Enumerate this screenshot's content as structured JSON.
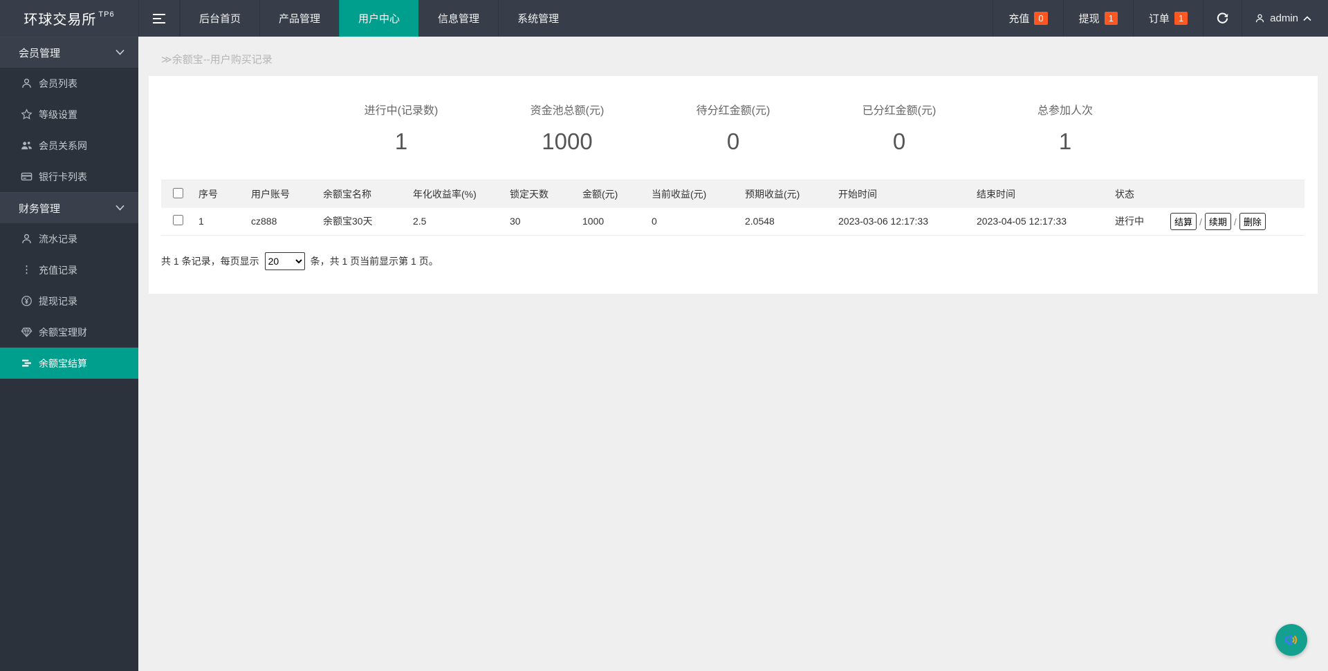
{
  "colors": {
    "teal": "#009e8c",
    "badge_orange": "#ff5722",
    "topbar_bg": "#373e4a",
    "sidebar_bg": "#2b323c",
    "page_bg": "#efefef"
  },
  "topbar": {
    "logo": "环球交易所",
    "logo_sup": "TP6",
    "nav": [
      {
        "label": "后台首页",
        "active": false
      },
      {
        "label": "产品管理",
        "active": false
      },
      {
        "label": "用户中心",
        "active": true
      },
      {
        "label": "信息管理",
        "active": false
      },
      {
        "label": "系统管理",
        "active": false
      }
    ],
    "right": {
      "recharge": {
        "label": "充值",
        "count": "0"
      },
      "withdraw": {
        "label": "提现",
        "count": "1"
      },
      "order": {
        "label": "订单",
        "count": "1"
      },
      "username": "admin"
    }
  },
  "sidebar": {
    "sections": [
      {
        "label": "会员管理",
        "items": [
          {
            "icon": "user-icon",
            "label": "会员列表"
          },
          {
            "icon": "star-icon",
            "label": "等级设置"
          },
          {
            "icon": "users-icon",
            "label": "会员关系网"
          },
          {
            "icon": "bank-card-icon",
            "label": "银行卡列表"
          }
        ]
      },
      {
        "label": "财务管理",
        "items": [
          {
            "icon": "user-icon",
            "label": "流水记录"
          },
          {
            "icon": "dots-icon",
            "label": "充值记录"
          },
          {
            "icon": "yen-circle-icon",
            "label": "提现记录"
          },
          {
            "icon": "gem-icon",
            "label": "余额宝理财"
          },
          {
            "icon": "list-icon",
            "label": "余额宝结算",
            "active": true
          }
        ]
      }
    ]
  },
  "breadcrumb": "≫余额宝--用户购买记录",
  "stats": [
    {
      "label": "进行中(记录数)",
      "value": "1"
    },
    {
      "label": "资金池总额(元)",
      "value": "1000"
    },
    {
      "label": "待分红金额(元)",
      "value": "0"
    },
    {
      "label": "已分红金额(元)",
      "value": "0"
    },
    {
      "label": "总参加人次",
      "value": "1"
    }
  ],
  "table": {
    "headers": [
      "序号",
      "用户账号",
      "余额宝名称",
      "年化收益率(%)",
      "锁定天数",
      "金额(元)",
      "当前收益(元)",
      "预期收益(元)",
      "开始时间",
      "结束时间",
      "状态"
    ],
    "row": {
      "cells": [
        "1",
        "cz888",
        "余额宝30天",
        "2.5",
        "30",
        "1000",
        "0",
        "2.0548",
        "2023-03-06 12:17:33",
        "2023-04-05 12:17:33",
        "进行中"
      ],
      "actions": [
        "结算",
        "续期",
        "删除"
      ]
    }
  },
  "pagination": {
    "text_before": "共 1 条记录，每页显示",
    "per_page": "20",
    "text_after": "条，共 1 页当前显示第 1 页。"
  }
}
